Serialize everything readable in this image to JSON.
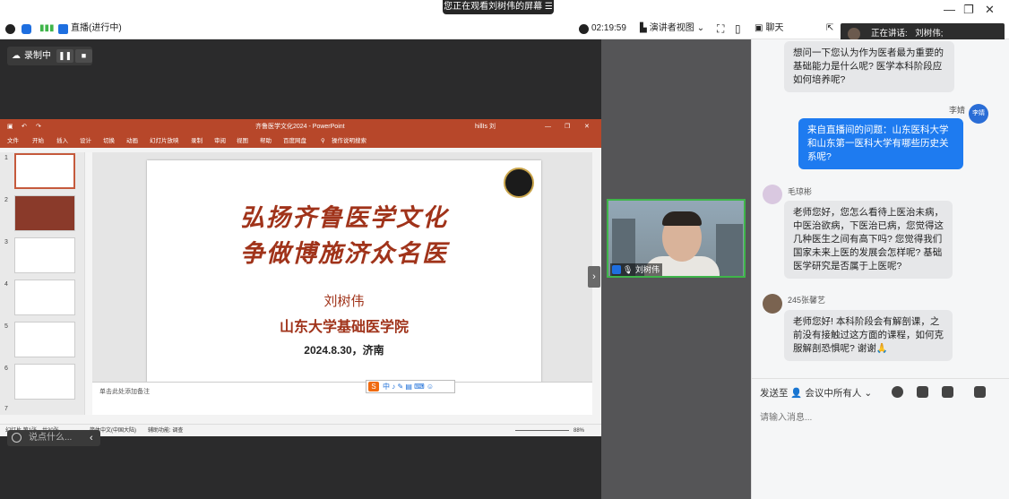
{
  "top": {
    "share_banner": "您正在观看刘树伟的屏幕",
    "live_status": "直播(进行中)",
    "timer": "02:19:59",
    "view_mode": "演讲者视图",
    "chat_label": "聊天",
    "speaking_label": "正在讲话:",
    "speaking_name": "刘树伟;"
  },
  "recording": {
    "label": "录制中"
  },
  "ppt": {
    "window_title": "齐鲁医学文化2024 - PowerPoint",
    "user": "hillIs 刘",
    "tabs": [
      "文件",
      "开始",
      "插入",
      "设计",
      "切换",
      "动画",
      "幻灯片放映",
      "录制",
      "审阅",
      "视图",
      "帮助",
      "百度网盘",
      "操作说明搜索"
    ],
    "slide": {
      "title_line1": "弘扬齐鲁医学文化",
      "title_line2": "争做博施济众名医",
      "author": "刘树伟",
      "org": "山东大学基础医学院",
      "date": "2024.8.30，济南"
    },
    "notes_placeholder": "单击此处添加备注",
    "status_slide": "幻灯片 第1张，共30张",
    "status_lang": "简体中文(中国大陆)",
    "status_access": "辅助功能: 调查",
    "zoom": "88%",
    "ime_mark": "S"
  },
  "say_placeholder": "说点什么...",
  "camera": {
    "name": "刘树伟"
  },
  "chat": {
    "messages": [
      {
        "text": "想问一下您认为作为医者最为重要的基础能力是什么呢? 医学本科阶段应如何培养呢?"
      },
      {
        "sender": "李婧",
        "avatar_text": "李婧",
        "text": "来自直播间的问题：山东医科大学和山东第一医科大学有哪些历史关系呢?"
      },
      {
        "sender": "毛琼彬",
        "text": "老师您好，您怎么看待上医治未病，中医治欲病，下医治已病，您觉得这几种医生之间有高下吗? 您觉得我们国家未来上医的发展会怎样呢? 基础医学研究是否属于上医呢?"
      },
      {
        "sender": "245张馨艺",
        "text": "老师您好! 本科阶段会有解剖课，之前没有接触过这方面的课程，如何克服解剖恐惧呢? 谢谢🙏"
      }
    ],
    "send_to_label": "发送至",
    "send_to_target": "会议中所有人",
    "input_placeholder": "请输入消息..."
  },
  "colors": {
    "accent": "#1e7bf0",
    "ppt_red": "#b7472a",
    "cam_border": "#3fb54a"
  }
}
